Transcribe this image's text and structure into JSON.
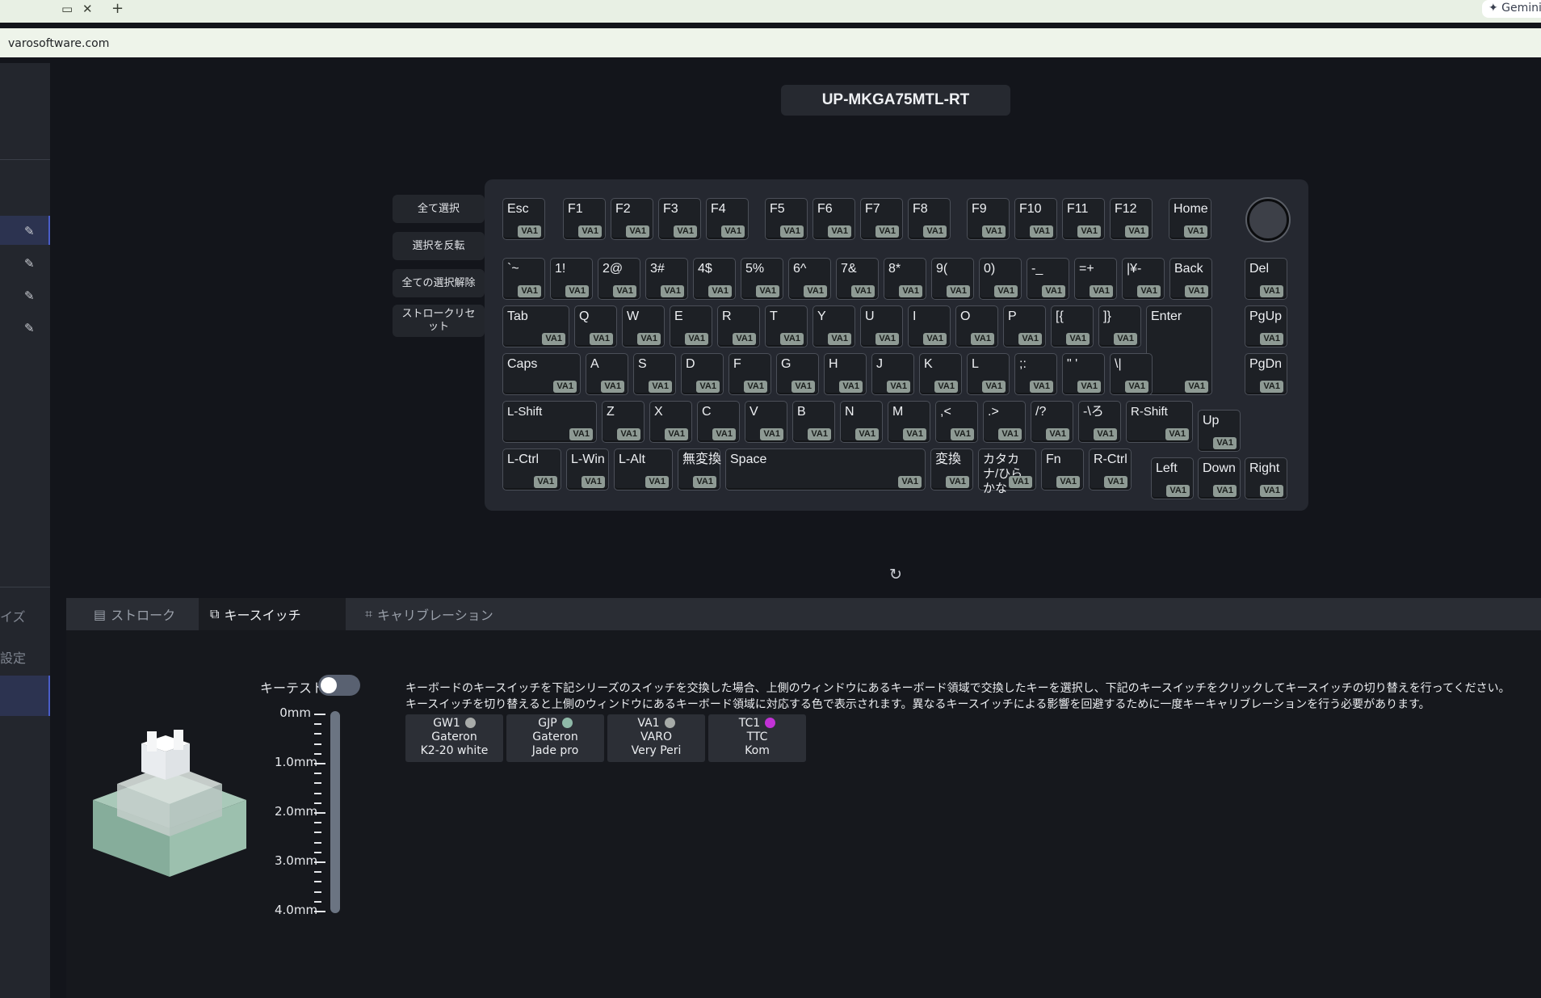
{
  "browser": {
    "url": "varosoftware.com",
    "new_tab_label": "+",
    "close_label": "✕",
    "gemini_label": "✦ Gemini"
  },
  "sidebar": {
    "items": [
      {
        "label": "イズ"
      },
      {
        "label": "設定"
      }
    ]
  },
  "header": {
    "model": "UP-MKGA75MTL-RT"
  },
  "actions": [
    {
      "label": "全て選択"
    },
    {
      "label": "選択を反転"
    },
    {
      "label": "全ての選択解除"
    },
    {
      "label": "ストロークリセット"
    }
  ],
  "keyboard": {
    "switch_badge": "VA1",
    "keys": [
      {
        "label": "Esc"
      },
      {
        "label": "F1"
      },
      {
        "label": "F2"
      },
      {
        "label": "F3"
      },
      {
        "label": "F4"
      },
      {
        "label": "F5"
      },
      {
        "label": "F6"
      },
      {
        "label": "F7"
      },
      {
        "label": "F8"
      },
      {
        "label": "F9"
      },
      {
        "label": "F10"
      },
      {
        "label": "F11"
      },
      {
        "label": "F12"
      },
      {
        "label": "Home"
      },
      {
        "label": "`~"
      },
      {
        "label": "1!"
      },
      {
        "label": "2@"
      },
      {
        "label": "3#"
      },
      {
        "label": "4$"
      },
      {
        "label": "5%"
      },
      {
        "label": "6^"
      },
      {
        "label": "7&"
      },
      {
        "label": "8*"
      },
      {
        "label": "9("
      },
      {
        "label": "0)"
      },
      {
        "label": "-_"
      },
      {
        "label": "=+"
      },
      {
        "label": "|¥-"
      },
      {
        "label": "Back"
      },
      {
        "label": "Del"
      },
      {
        "label": "Tab"
      },
      {
        "label": "Q"
      },
      {
        "label": "W"
      },
      {
        "label": "E"
      },
      {
        "label": "R"
      },
      {
        "label": "T"
      },
      {
        "label": "Y"
      },
      {
        "label": "U"
      },
      {
        "label": "I"
      },
      {
        "label": "O"
      },
      {
        "label": "P"
      },
      {
        "label": "[{"
      },
      {
        "label": "]}"
      },
      {
        "label": "Enter"
      },
      {
        "label": "PgUp"
      },
      {
        "label": "Caps"
      },
      {
        "label": "A"
      },
      {
        "label": "S"
      },
      {
        "label": "D"
      },
      {
        "label": "F"
      },
      {
        "label": "G"
      },
      {
        "label": "H"
      },
      {
        "label": "J"
      },
      {
        "label": "K"
      },
      {
        "label": "L"
      },
      {
        "label": ";:"
      },
      {
        "label": "\" '"
      },
      {
        "label": "\\|"
      },
      {
        "label": "PgDn"
      },
      {
        "label": "L-Shift"
      },
      {
        "label": "Z"
      },
      {
        "label": "X"
      },
      {
        "label": "C"
      },
      {
        "label": "V"
      },
      {
        "label": "B"
      },
      {
        "label": "N"
      },
      {
        "label": "M"
      },
      {
        "label": ",<"
      },
      {
        "label": ".>"
      },
      {
        "label": "/?"
      },
      {
        "label": "-\\ろ"
      },
      {
        "label": "R-Shift"
      },
      {
        "label": "Up"
      },
      {
        "label": "L-Ctrl"
      },
      {
        "label": "L-Win"
      },
      {
        "label": "L-Alt"
      },
      {
        "label": "無変換"
      },
      {
        "label": "Space"
      },
      {
        "label": "変換"
      },
      {
        "label": "カタカナ/ひらかな"
      },
      {
        "label": "Fn"
      },
      {
        "label": "R-Ctrl"
      },
      {
        "label": "Left"
      },
      {
        "label": "Down"
      },
      {
        "label": "Right"
      }
    ]
  },
  "tabs": [
    {
      "label": "ストローク"
    },
    {
      "label": "キースイッチ"
    },
    {
      "label": "キャリブレーション"
    }
  ],
  "keytest": {
    "label": "キーテスト"
  },
  "ruler": {
    "ticks": [
      "0mm",
      "1.0mm",
      "2.0mm",
      "3.0mm",
      "4.0mm"
    ]
  },
  "description": {
    "line1": "キーボードのキースイッチを下記シリーズのスイッチを交換した場合、上側のウィンドウにあるキーボード領域で交換したキーを選択し、下記のキースイッチをクリックしてキースイッチの切り替えを行ってください。",
    "line2": "キースイッチを切り替えると上側のウィンドウにあるキーボード領域に対応する色で表示されます。異なるキースイッチによる影響を回避するために一度キーキャリブレーションを行う必要があります。"
  },
  "switches": [
    {
      "code": "GW1",
      "brand": "Gateron",
      "model": "K2-20 white",
      "color": "#a8aba9"
    },
    {
      "code": "GJP",
      "brand": "Gateron",
      "model": "Jade pro",
      "color": "#8fb9a8"
    },
    {
      "code": "VA1",
      "brand": "VARO",
      "model": "Very Peri",
      "color": "#a6aba8"
    },
    {
      "code": "TC1",
      "brand": "TTC",
      "model": "Kom",
      "color": "#c232d6"
    }
  ]
}
